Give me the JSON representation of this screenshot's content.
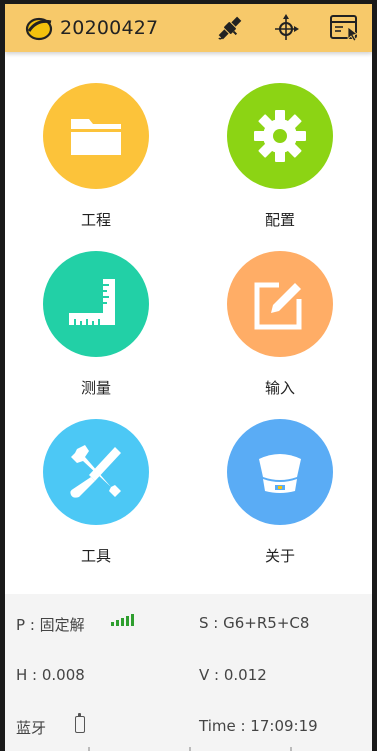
{
  "header": {
    "title": "20200427",
    "icons": [
      "app-logo",
      "satellite-icon",
      "position-target-icon",
      "window-cursor-icon"
    ]
  },
  "tiles": [
    {
      "label": "工程",
      "icon": "folder-icon",
      "color": "#fcc33a"
    },
    {
      "label": "配置",
      "icon": "gear-icon",
      "color": "#8cd414"
    },
    {
      "label": "测量",
      "icon": "ruler-icon",
      "color": "#22d0a6"
    },
    {
      "label": "输入",
      "icon": "edit-icon",
      "color": "#ffad66"
    },
    {
      "label": "工具",
      "icon": "tools-icon",
      "color": "#4cc8f5"
    },
    {
      "label": "关于",
      "icon": "receiver-icon",
      "color": "#5aacf5"
    }
  ],
  "status": {
    "p_label": "P : 固定解",
    "s_label": "S : G6+R5+C8",
    "h_label": "H : 0.008",
    "v_label": "V : 0.012",
    "bt_label": "蓝牙",
    "time_label": "Time :  17:09:19",
    "signal_color": "#2e9e2e"
  }
}
